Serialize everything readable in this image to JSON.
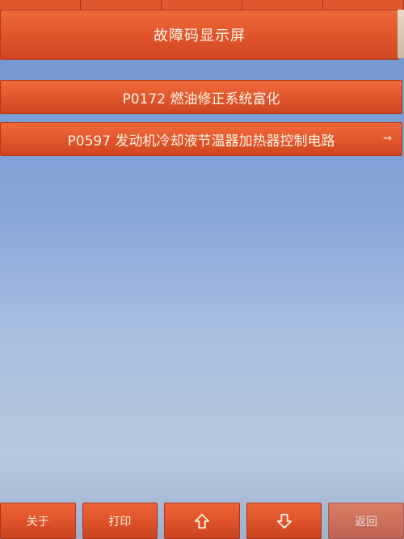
{
  "screen_title": "故障码显示屏",
  "codes": [
    {
      "label": "P0172 燃油修正系统富化"
    },
    {
      "label": "P0597 发动机冷却液节温器加热器控制电路"
    }
  ],
  "icons": {
    "more": "arrow-right-icon",
    "up": "arrow-up-icon",
    "down": "arrow-down-icon"
  },
  "bottom_bar": {
    "about_label": "关于",
    "print_label": "打印",
    "back_label": "返回"
  },
  "colors": {
    "accent": "#e2582e",
    "text_on_accent": "#fff4e6",
    "background": "#9fb6df"
  }
}
